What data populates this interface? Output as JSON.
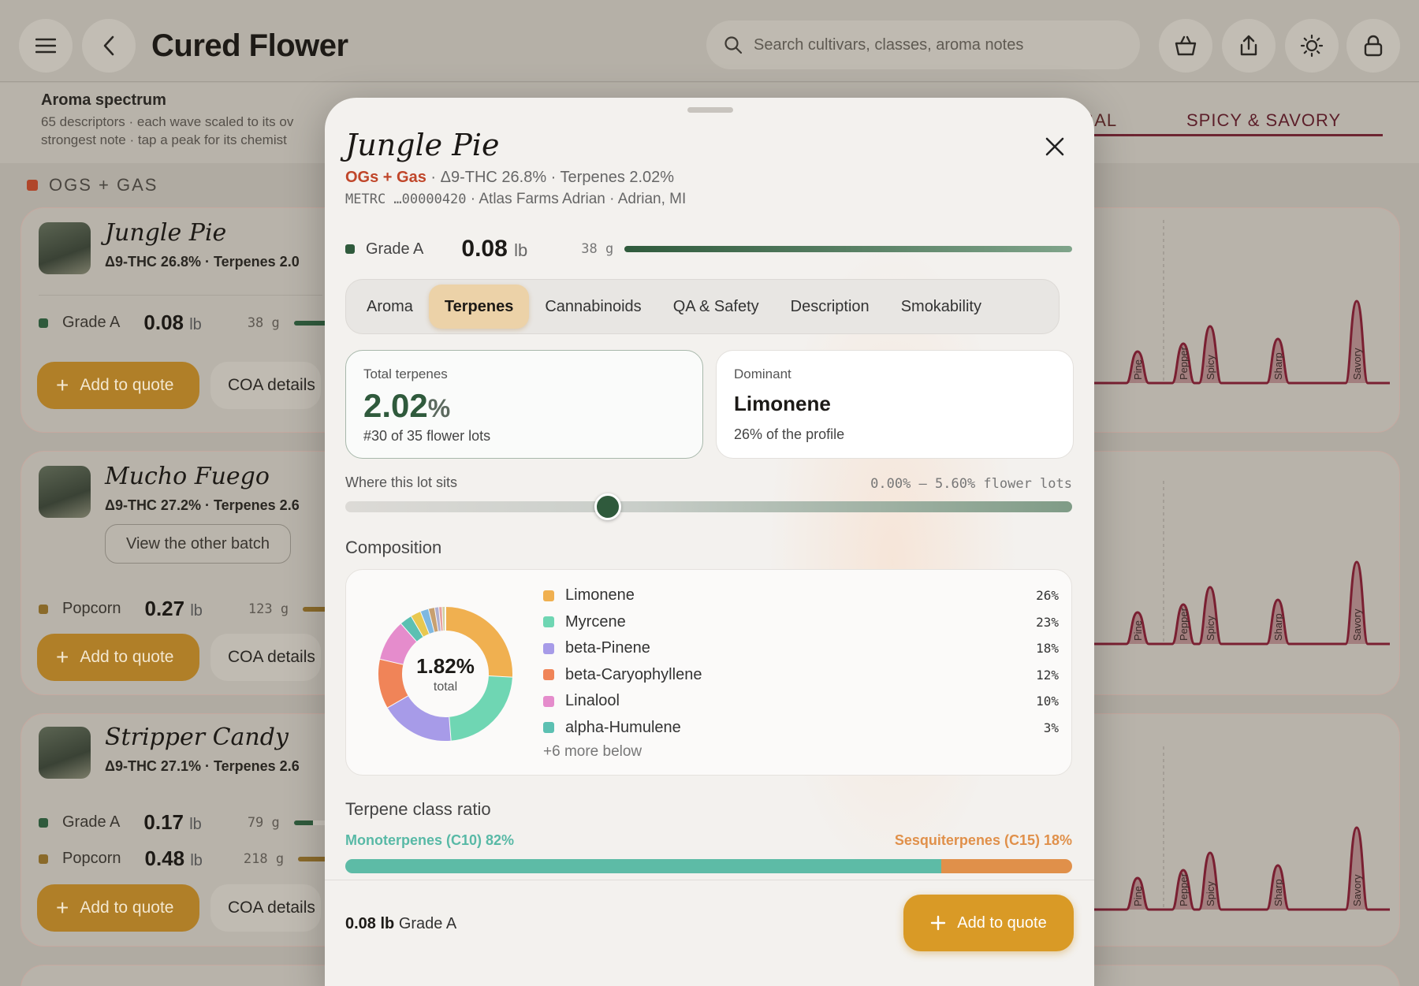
{
  "app": {
    "title": "Cured Flower",
    "search_placeholder": "Search cultivars, classes, aroma notes",
    "icons": [
      "menu-icon",
      "back-icon",
      "search-icon",
      "basket-icon",
      "share-icon",
      "theme-icon",
      "lock-icon"
    ]
  },
  "spectrum": {
    "title": "Aroma spectrum",
    "description": "65 descriptors · each wave scaled to its ov\nstrongest note · tap a peak for its chemist",
    "categories": [
      "ERBAL",
      "SPICY & SAVORY"
    ]
  },
  "section": {
    "label": "OGS + GAS",
    "color": "#b0462a"
  },
  "cards": [
    {
      "name": "Jungle Pie",
      "thc": "Δ9-THC 26.8%",
      "terp": "Terpenes 2.0",
      "rows": [
        {
          "grade": "Grade A",
          "weight": "0.08",
          "unit": "lb",
          "grams": "38  g",
          "color": "#2f5a3c"
        }
      ],
      "add_label": "Add to quote",
      "coa_label": "COA details"
    },
    {
      "name": "Mucho Fuego",
      "thc": "Δ9-THC 27.2%",
      "terp": "Terpenes 2.6",
      "other_label": "View the other batch",
      "rows": [
        {
          "grade": "Popcorn",
          "weight": "0.27",
          "unit": "lb",
          "grams": "123  g",
          "color": "#8a6a2a"
        }
      ],
      "add_label": "Add to quote",
      "coa_label": "COA details"
    },
    {
      "name": "Stripper Candy",
      "thc": "Δ9-THC 27.1%",
      "terp": "Terpenes 2.6",
      "rows": [
        {
          "grade": "Grade A",
          "weight": "0.17",
          "unit": "lb",
          "grams": "79  g",
          "color": "#2f5a3c"
        },
        {
          "grade": "Popcorn",
          "weight": "0.48",
          "unit": "lb",
          "grams": "218  g",
          "color": "#8a6a2a"
        }
      ],
      "add_label": "Add to quote",
      "coa_label": "COA details"
    }
  ],
  "wave_labels": [
    "Pine",
    "Pepper",
    "Spicy",
    "Sharp",
    "Savory"
  ],
  "modal": {
    "title": "Jungle Pie",
    "class": "OGs + Gas",
    "subtitle_rest": " · Δ9-THC 26.8% · Terpenes 2.02%",
    "metrc_code": "METRC …00000420",
    "source": " · Atlas Farms Adrian · Adrian, MI",
    "grade": "Grade A",
    "weight": "0.08",
    "unit": "lb",
    "grams": "38  g",
    "tabs": [
      "Aroma",
      "Terpenes",
      "Cannabinoids",
      "QA & Safety",
      "Description",
      "Smokability"
    ],
    "active_tab": "Terpenes",
    "total_terpenes": {
      "label": "Total terpenes",
      "value": "2.02",
      "unit": "%",
      "rank": "#30 of 35 flower lots"
    },
    "dominant": {
      "label": "Dominant",
      "value": "Limonene",
      "sub": "26% of the profile"
    },
    "where": {
      "label": "Where this lot sits",
      "range": "0.00% — 5.60% flower lots",
      "position": 0.361
    },
    "composition": {
      "label": "Composition",
      "center_value": "1.82%",
      "center_label": "total",
      "items": [
        {
          "name": "Limonene",
          "pct": "26%",
          "value": 26,
          "color": "#f0b050"
        },
        {
          "name": "Myrcene",
          "pct": "23%",
          "value": 23,
          "color": "#6fd6b3"
        },
        {
          "name": "beta-Pinene",
          "pct": "18%",
          "value": 18,
          "color": "#a79be8"
        },
        {
          "name": "beta-Caryophyllene",
          "pct": "12%",
          "value": 12,
          "color": "#f08458"
        },
        {
          "name": "Linalool",
          "pct": "10%",
          "value": 10,
          "color": "#e58ccc"
        },
        {
          "name": "alpha-Humulene",
          "pct": "3%",
          "value": 3,
          "color": "#5cc0b2"
        }
      ],
      "hidden_values": [
        2.5,
        2,
        1.5,
        1,
        0.8,
        0.7
      ],
      "hidden_colors": [
        "#e8c850",
        "#7fb8e0",
        "#c8a070",
        "#b0b0d0",
        "#e8a0a0",
        "#d0d0a0"
      ],
      "more_label": "+6 more below"
    },
    "ratio": {
      "label": "Terpene class ratio",
      "mono_label": "Monoterpenes (C10) 82%",
      "ses_label": "Sesquiterpenes (C15) 18%",
      "mono_fraction": 0.82
    },
    "footer": {
      "weight": "0.08 lb",
      "grade": " Grade A",
      "add_label": "Add to quote"
    }
  }
}
